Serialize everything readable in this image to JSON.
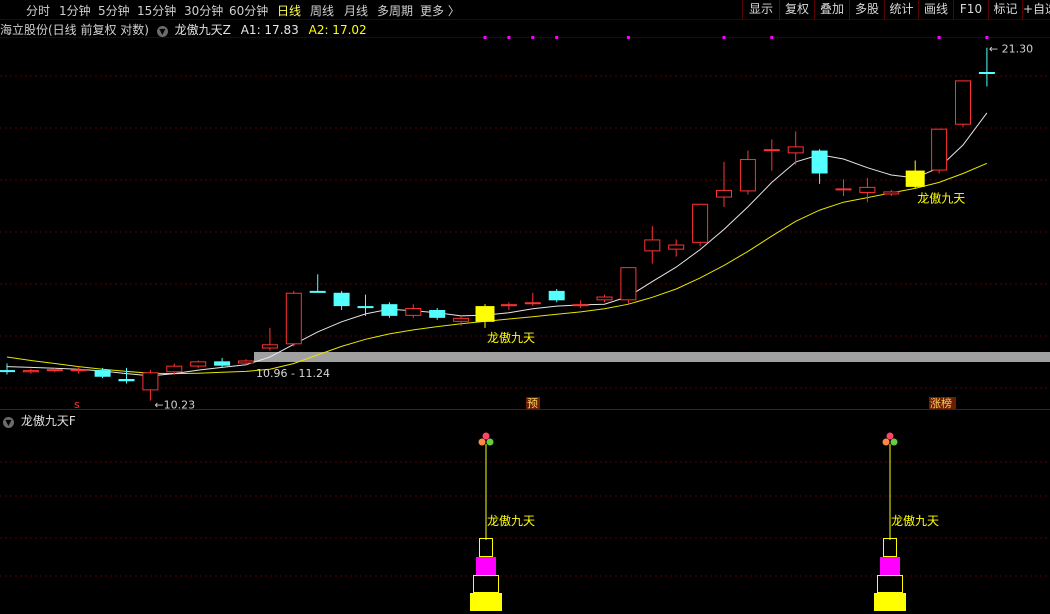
{
  "toolbar": {
    "periods": [
      {
        "label": "分时",
        "x": 26
      },
      {
        "label": "1分钟",
        "x": 59
      },
      {
        "label": "5分钟",
        "x": 98
      },
      {
        "label": "15分钟",
        "x": 137
      },
      {
        "label": "30分钟",
        "x": 184
      },
      {
        "label": "60分钟",
        "x": 229
      },
      {
        "label": "日线",
        "x": 277
      },
      {
        "label": "周线",
        "x": 310
      },
      {
        "label": "月线",
        "x": 344
      },
      {
        "label": "多周期",
        "x": 377
      },
      {
        "label": "更多 〉",
        "x": 420
      }
    ],
    "active_period": "日线",
    "buttons": [
      "显示",
      "复权",
      "叠加",
      "多股",
      "统计",
      "画线",
      "F10",
      "标记",
      "+自选"
    ]
  },
  "info": {
    "stock_name": "海立股份(日线 前复权 对数)",
    "formula_name": "龙傲九天Z",
    "a1": "A1: 17.83",
    "a2": "A2: 17.02"
  },
  "sub_panel": {
    "name": "龙傲九天F"
  },
  "price_labels": {
    "high": "21.30",
    "low": "10.23",
    "range": "10.96 - 11.24"
  },
  "signal_label": "龙傲九天",
  "markers": {
    "s": "s",
    "forecast": "预",
    "limit_up": "涨榜"
  },
  "colors": {
    "up": "#ff3232",
    "down": "#54ffff",
    "signal": "#ffff00",
    "ma_fast": "#e6e6e6",
    "ma_slow": "#e6e600",
    "grid": "#5a0000",
    "dot": "#ff00ff"
  },
  "chart_data": {
    "type": "candlestick",
    "candles": [
      {
        "o": 10.9,
        "c": 10.9,
        "h": 11.05,
        "l": 10.8,
        "dir": "down"
      },
      {
        "o": 10.85,
        "c": 10.9,
        "h": 10.93,
        "l": 10.82,
        "dir": "up"
      },
      {
        "o": 10.88,
        "c": 10.92,
        "h": 10.95,
        "l": 10.85,
        "dir": "up"
      },
      {
        "o": 10.92,
        "c": 10.88,
        "h": 10.98,
        "l": 10.82,
        "dir": "up"
      },
      {
        "o": 10.9,
        "c": 10.75,
        "h": 10.95,
        "l": 10.72,
        "dir": "down"
      },
      {
        "o": 10.7,
        "c": 10.65,
        "h": 10.95,
        "l": 10.6,
        "dir": "down"
      },
      {
        "o": 10.45,
        "c": 10.85,
        "h": 10.9,
        "l": 10.23,
        "dir": "up"
      },
      {
        "o": 10.85,
        "c": 11.0,
        "h": 11.05,
        "l": 10.8,
        "dir": "up"
      },
      {
        "o": 10.98,
        "c": 11.1,
        "h": 11.12,
        "l": 10.95,
        "dir": "up"
      },
      {
        "o": 11.1,
        "c": 11.0,
        "h": 11.18,
        "l": 10.95,
        "dir": "down"
      },
      {
        "o": 11.05,
        "c": 11.12,
        "h": 11.15,
        "l": 11.0,
        "dir": "up"
      },
      {
        "o": 11.4,
        "c": 11.5,
        "h": 11.9,
        "l": 11.35,
        "dir": "up"
      },
      {
        "o": 11.5,
        "c": 12.8,
        "h": 12.85,
        "l": 11.45,
        "dir": "up"
      },
      {
        "o": 12.85,
        "c": 12.85,
        "h": 13.3,
        "l": 12.85,
        "dir": "down"
      },
      {
        "o": 12.8,
        "c": 12.45,
        "h": 12.85,
        "l": 12.35,
        "dir": "down"
      },
      {
        "o": 12.45,
        "c": 12.4,
        "h": 12.75,
        "l": 12.2,
        "dir": "down"
      },
      {
        "o": 12.5,
        "c": 12.2,
        "h": 12.55,
        "l": 12.15,
        "dir": "down"
      },
      {
        "o": 12.2,
        "c": 12.4,
        "h": 12.5,
        "l": 12.15,
        "dir": "up"
      },
      {
        "o": 12.35,
        "c": 12.15,
        "h": 12.4,
        "l": 12.1,
        "dir": "down"
      },
      {
        "o": 12.15,
        "c": 12.05,
        "h": 12.2,
        "l": 11.95,
        "dir": "up"
      },
      {
        "o": 12.05,
        "c": 12.45,
        "h": 12.5,
        "l": 11.9,
        "dir": "signal"
      },
      {
        "o": 12.45,
        "c": 12.5,
        "h": 12.55,
        "l": 12.35,
        "dir": "up"
      },
      {
        "o": 12.5,
        "c": 12.55,
        "h": 12.8,
        "l": 12.45,
        "dir": "up"
      },
      {
        "o": 12.85,
        "c": 12.6,
        "h": 12.9,
        "l": 12.55,
        "dir": "down"
      },
      {
        "o": 12.45,
        "c": 12.5,
        "h": 12.6,
        "l": 12.4,
        "dir": "up"
      },
      {
        "o": 12.6,
        "c": 12.7,
        "h": 12.75,
        "l": 12.55,
        "dir": "up"
      },
      {
        "o": 12.6,
        "c": 13.5,
        "h": 13.5,
        "l": 12.5,
        "dir": "up"
      },
      {
        "o": 13.95,
        "c": 14.3,
        "h": 14.7,
        "l": 13.6,
        "dir": "up"
      },
      {
        "o": 14.0,
        "c": 14.15,
        "h": 14.3,
        "l": 13.8,
        "dir": "up"
      },
      {
        "o": 14.2,
        "c": 15.4,
        "h": 15.4,
        "l": 14.1,
        "dir": "up"
      },
      {
        "o": 15.6,
        "c": 15.85,
        "h": 16.8,
        "l": 15.3,
        "dir": "up"
      },
      {
        "o": 15.8,
        "c": 16.9,
        "h": 17.2,
        "l": 15.7,
        "dir": "up"
      },
      {
        "o": 17.2,
        "c": 17.25,
        "h": 17.6,
        "l": 16.5,
        "dir": "up"
      },
      {
        "o": 17.1,
        "c": 17.35,
        "h": 17.9,
        "l": 16.7,
        "dir": "up"
      },
      {
        "o": 17.2,
        "c": 16.4,
        "h": 17.25,
        "l": 16.05,
        "dir": "down"
      },
      {
        "o": 15.85,
        "c": 15.9,
        "h": 16.2,
        "l": 15.65,
        "dir": "up"
      },
      {
        "o": 15.75,
        "c": 15.95,
        "h": 16.25,
        "l": 15.45,
        "dir": "up"
      },
      {
        "o": 15.7,
        "c": 15.8,
        "h": 15.85,
        "l": 15.65,
        "dir": "up"
      },
      {
        "o": 15.95,
        "c": 16.5,
        "h": 16.85,
        "l": 15.9,
        "dir": "signal"
      },
      {
        "o": 16.5,
        "c": 18.0,
        "h": 18.0,
        "l": 16.4,
        "dir": "up"
      },
      {
        "o": 18.15,
        "c": 19.9,
        "h": 19.9,
        "l": 18.05,
        "dir": "up"
      },
      {
        "o": 20.25,
        "c": 20.25,
        "h": 21.3,
        "l": 19.65,
        "dir": "down"
      }
    ],
    "ma_fast": [
      10.98,
      10.96,
      10.94,
      10.92,
      10.88,
      10.82,
      10.77,
      10.82,
      10.9,
      10.96,
      11.02,
      11.2,
      11.5,
      11.8,
      12.05,
      12.25,
      12.37,
      12.33,
      12.28,
      12.2,
      12.22,
      12.28,
      12.38,
      12.45,
      12.48,
      12.5,
      12.7,
      13.1,
      13.5,
      14.0,
      14.6,
      15.3,
      16.1,
      16.8,
      17.05,
      16.9,
      16.6,
      16.35,
      16.25,
      16.6,
      17.4,
      18.6
    ],
    "ma_slow": [
      11.2,
      11.12,
      11.05,
      10.98,
      10.92,
      10.87,
      10.83,
      10.82,
      10.83,
      10.85,
      10.87,
      10.92,
      11.05,
      11.25,
      11.45,
      11.62,
      11.75,
      11.85,
      11.93,
      12.0,
      12.06,
      12.12,
      12.18,
      12.24,
      12.3,
      12.38,
      12.5,
      12.68,
      12.9,
      13.2,
      13.55,
      13.95,
      14.4,
      14.85,
      15.2,
      15.45,
      15.6,
      15.75,
      15.9,
      16.1,
      16.4,
      16.75
    ],
    "magenta_dots_index": [
      20,
      21,
      22,
      23,
      26,
      30,
      32,
      39,
      41
    ],
    "signals_index": [
      20,
      38
    ],
    "ylim": [
      10.0,
      22.0
    ],
    "scale": "log"
  }
}
